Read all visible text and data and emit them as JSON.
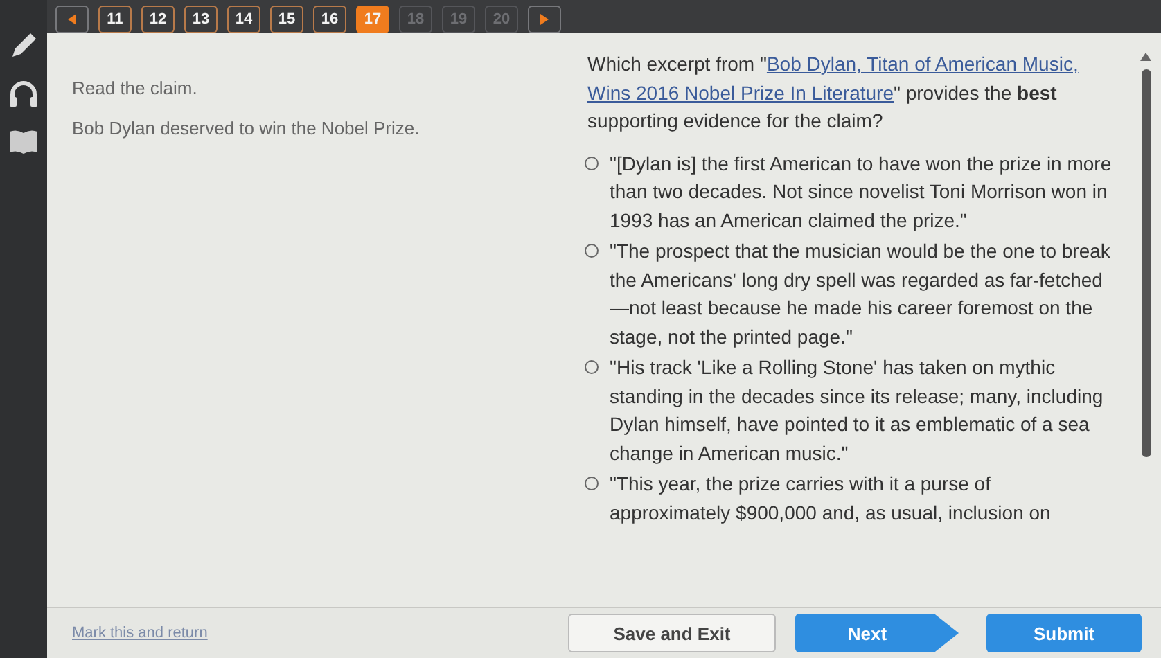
{
  "nav": {
    "buttons": [
      {
        "label": "11",
        "selected": false,
        "disabled": false
      },
      {
        "label": "12",
        "selected": false,
        "disabled": false
      },
      {
        "label": "13",
        "selected": false,
        "disabled": false
      },
      {
        "label": "14",
        "selected": false,
        "disabled": false
      },
      {
        "label": "15",
        "selected": false,
        "disabled": false
      },
      {
        "label": "16",
        "selected": false,
        "disabled": false
      },
      {
        "label": "17",
        "selected": true,
        "disabled": false
      },
      {
        "label": "18",
        "selected": false,
        "disabled": true
      },
      {
        "label": "19",
        "selected": false,
        "disabled": true
      },
      {
        "label": "20",
        "selected": false,
        "disabled": true
      }
    ]
  },
  "claim": {
    "prompt": "Read the claim.",
    "statement": "Bob Dylan deserved to win the Nobel Prize."
  },
  "question": {
    "before": "Which excerpt from \"",
    "source": "Bob Dylan, Titan of American Music, Wins 2016 Nobel Prize In Literature",
    "after": "\" provides the **best** supporting evidence for the claim?"
  },
  "options": [
    {
      "text": "\"[Dylan is] the first American to have won the prize in more than two decades. Not since novelist Toni Morrison won in 1993 has an American claimed the prize.\"",
      "selected": false
    },
    {
      "text": "\"The prospect that the musician would be the one to break the Americans' long dry spell was regarded as far-fetched—not least because he made his career foremost on the stage, not the printed page.\"",
      "selected": false
    },
    {
      "text": "\"His track 'Like a Rolling Stone' has taken on mythic standing in the decades since its release; many, including Dylan himself, have pointed to it as emblematic of a sea change in American music.\"",
      "selected": false
    },
    {
      "text": "\"This year, the prize carries with it a purse of approximately $900,000 and, as usual, inclusion on",
      "selected": false
    }
  ],
  "footer": {
    "mark_link": "Mark this and return",
    "buttons": [
      {
        "label": "Save and Exit",
        "kind": "secondary"
      },
      {
        "label": "Next",
        "kind": "next"
      },
      {
        "label": "Submit",
        "kind": "primary"
      }
    ]
  }
}
